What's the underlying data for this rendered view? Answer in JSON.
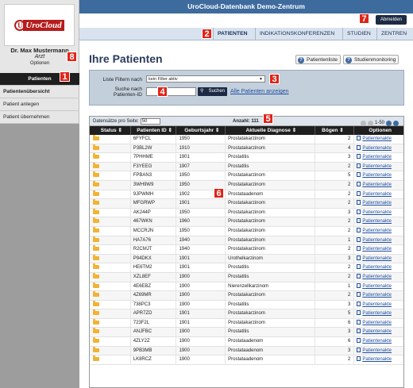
{
  "app": {
    "title": "UroCloud-Datenbank Demo-Zentrum",
    "logo_text": "UroCloud",
    "logout_label": "Abmelden"
  },
  "user": {
    "name": "Dr. Max Mustermann",
    "role": "Arzt",
    "options": "Optionen"
  },
  "sidebar": {
    "items": [
      {
        "label": "Patienten"
      },
      {
        "label": "Patientenübersicht"
      },
      {
        "label": "Patient anlegen"
      },
      {
        "label": "Patient übernehmen"
      }
    ]
  },
  "tabs": [
    {
      "label": "PATIENTEN"
    },
    {
      "label": "INDIKATIONSKONFERENZEN"
    },
    {
      "label": "STUDIEN"
    },
    {
      "label": "ZENTREN"
    }
  ],
  "main": {
    "heading": "Ihre Patienten",
    "btn_list": "Patientenliste",
    "btn_monitor": "Studienmonitoring"
  },
  "filter": {
    "label_filter": "Liste Filtern nach",
    "filter_value": "kein Filter aktiv",
    "label_search": "Suche nach Patienten-ID",
    "search_value": "",
    "search_button": "Suchen",
    "show_all": "Alle Patienten anzeigen"
  },
  "grid": {
    "per_page_label": "Datensätze pro Seite:",
    "per_page_value": "50",
    "count_label": "Anzahl: 111",
    "page_range": "1-50",
    "columns": [
      "Status",
      "Patienten ID",
      "Geburtsjahr",
      "Aktuelle Diagnose",
      "Bögen",
      "Optionen"
    ],
    "rows": [
      {
        "id": "6FYFCL",
        "year": "1950",
        "diag": "Prostatakarzinom",
        "boegen": "2",
        "opt": "Patientenakte"
      },
      {
        "id": "P3BL2W",
        "year": "1910",
        "diag": "Prostatakarzinom",
        "boegen": "4",
        "opt": "Patientenakte"
      },
      {
        "id": "7PHHME",
        "year": "1901",
        "diag": "Prostatitis",
        "boegen": "3",
        "opt": "Patientenakte"
      },
      {
        "id": "F3YEEG",
        "year": "1907",
        "diag": "Prostatitis",
        "boegen": "2",
        "opt": "Patientenakte"
      },
      {
        "id": "FPBAN3",
        "year": "1950",
        "diag": "Prostatakarzinom",
        "boegen": "5",
        "opt": "Patientenakte"
      },
      {
        "id": "3WH9W9",
        "year": "1950",
        "diag": "Prostatakarzinom",
        "boegen": "2",
        "opt": "Patientenakte"
      },
      {
        "id": "9JPWMH",
        "year": "1902",
        "diag": "Prostataadenom",
        "boegen": "2",
        "opt": "Patientenakte"
      },
      {
        "id": "MFGRWP",
        "year": "1901",
        "diag": "Prostatakarzinom",
        "boegen": "2",
        "opt": "Patientenakte"
      },
      {
        "id": "AK244P",
        "year": "1950",
        "diag": "Prostatakarzinom",
        "boegen": "3",
        "opt": "Patientenakte"
      },
      {
        "id": "467WKN",
        "year": "1960",
        "diag": "Prostatakarzinom",
        "boegen": "2",
        "opt": "Patientenakte"
      },
      {
        "id": "MCCRJN",
        "year": "1950",
        "diag": "Prostatakarzinom",
        "boegen": "2",
        "opt": "Patientenakte"
      },
      {
        "id": "HA7A76",
        "year": "1940",
        "diag": "Prostatakarzinom",
        "boegen": "1",
        "opt": "Patientenakte"
      },
      {
        "id": "R2CMJT",
        "year": "1940",
        "diag": "Prostatakarzinom",
        "boegen": "2",
        "opt": "Patientenakte"
      },
      {
        "id": "P94DKX",
        "year": "1901",
        "diag": "Urothelkarzinom",
        "boegen": "3",
        "opt": "Patientenakte"
      },
      {
        "id": "HE6TM2",
        "year": "1901",
        "diag": "Prostatitis",
        "boegen": "2",
        "opt": "Patientenakte"
      },
      {
        "id": "XZL8EF",
        "year": "1900",
        "diag": "Prostatitis",
        "boegen": "2",
        "opt": "Patientenakte"
      },
      {
        "id": "4E6EBZ",
        "year": "1900",
        "diag": "Nierenzellkarzinom",
        "boegen": "1",
        "opt": "Patientenakte"
      },
      {
        "id": "4Z69MR",
        "year": "1900",
        "diag": "Prostatakarzinom",
        "boegen": "2",
        "opt": "Patientenakte"
      },
      {
        "id": "738PC3",
        "year": "1900",
        "diag": "Prostatitis",
        "boegen": "3",
        "opt": "Patientenakte"
      },
      {
        "id": "APR7ZD",
        "year": "1901",
        "diag": "Prostatakarzinom",
        "boegen": "5",
        "opt": "Patientenakte"
      },
      {
        "id": "723F2L",
        "year": "1901",
        "diag": "Prostatakarzinom",
        "boegen": "6",
        "opt": "Patientenakte"
      },
      {
        "id": "ANJFBC",
        "year": "1900",
        "diag": "Prostatitis",
        "boegen": "3",
        "opt": "Patientenakte"
      },
      {
        "id": "4ZLY2Z",
        "year": "1900",
        "diag": "Prostataadenom",
        "boegen": "6",
        "opt": "Patientenakte"
      },
      {
        "id": "9PB3MB",
        "year": "1900",
        "diag": "Prostataadenom",
        "boegen": "3",
        "opt": "Patientenakte"
      },
      {
        "id": "LK8RCZ",
        "year": "1900",
        "diag": "Prostataadenom",
        "boegen": "2",
        "opt": "Patientenakte"
      }
    ]
  },
  "badges": [
    "1",
    "2",
    "3",
    "4",
    "5",
    "6",
    "7",
    "8"
  ]
}
